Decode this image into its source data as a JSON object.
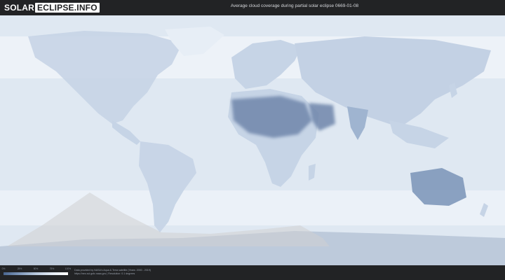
{
  "header": {
    "logo_left": "SOLAR",
    "logo_right": "ECLIPSE.INFO",
    "title": "Average cloud coverage during partial solar eclipse 0669-01-08"
  },
  "map": {
    "ocean_color": "#dfe8f2",
    "land_color": "#c6d4e6",
    "desert_color": "#6f86ab",
    "eclipse_overlay_color": "#cfcfd1",
    "antarctica_color": "#bdcadb"
  },
  "legend": {
    "ticks": [
      "0%",
      "25%",
      "50%",
      "75%",
      "100%"
    ],
    "gradient": [
      "#4a6690",
      "#7f98ba",
      "#b7c7dc",
      "#e4ebf4",
      "#ffffff"
    ]
  },
  "footer": {
    "credit_line1": "Data provided by NASA's Aqua & Terra satellite (Years: 2000 - 2019)",
    "credit_line2": "https://neo.sci.gsfc.nasa.gov  |  Resolution: 0.1 degrees"
  }
}
